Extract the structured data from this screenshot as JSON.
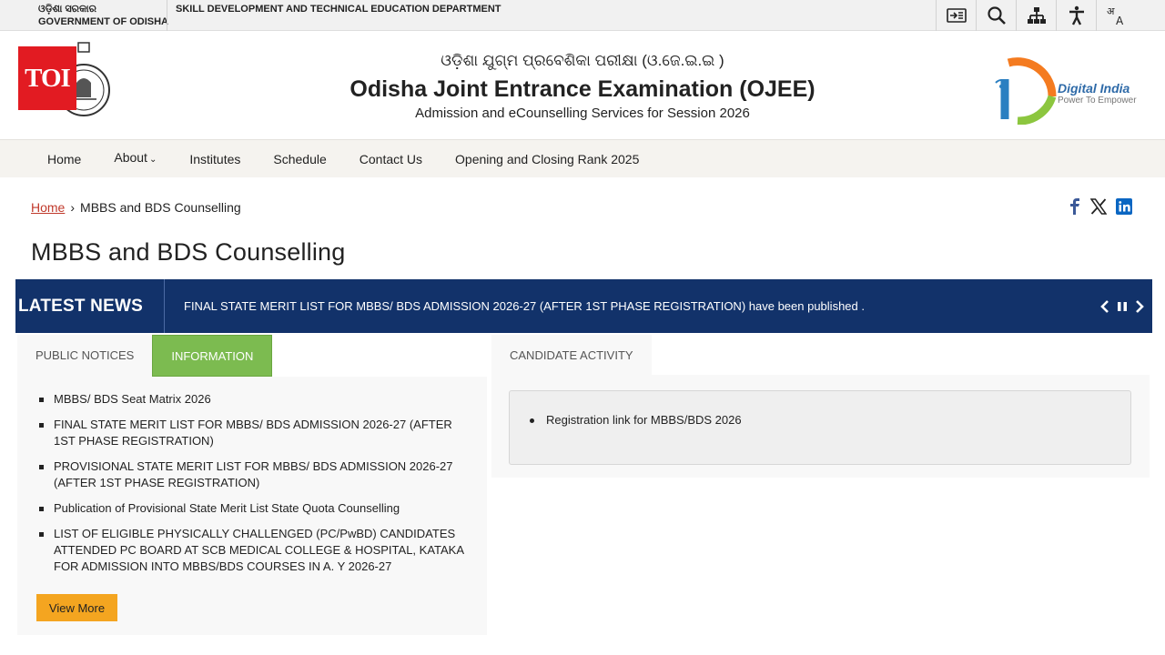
{
  "topbar": {
    "gov_line1": "ଓଡ଼ିଶା ସରକାର",
    "gov_line2": "GOVERNMENT OF ODISHA",
    "department": "SKILL DEVELOPMENT AND TECHNICAL EDUCATION DEPARTMENT",
    "tools": [
      {
        "icon": "skip-to-content-icon"
      },
      {
        "icon": "search-icon"
      },
      {
        "icon": "sitemap-icon"
      },
      {
        "icon": "accessibility-icon"
      },
      {
        "icon": "language-icon"
      }
    ]
  },
  "header": {
    "toi_badge": "TOI",
    "odia_title": "ଓଡ଼ିଶା ଯୁଗ୍ମ ପ୍ରବେଶିକା ପରୀକ୍ଷା (ଓ.ଜେ.ଇ.ଇ )",
    "title": "Odisha Joint Entrance Examination (OJEE)",
    "subtitle": "Admission and eCounselling Services for Session 2026",
    "digital_india": "Digital India",
    "digital_india_tag": "Power To Empower"
  },
  "nav": {
    "items": [
      "Home",
      "About",
      "Institutes",
      "Schedule",
      "Contact Us",
      "Opening and Closing Rank 2025"
    ]
  },
  "breadcrumb": {
    "home": "Home",
    "separator": "›",
    "current": "MBBS and BDS Counselling"
  },
  "social": [
    "facebook-icon",
    "x-icon",
    "linkedin-icon"
  ],
  "page_title": "MBBS and BDS Counselling",
  "latest_news": {
    "label": "LATEST NEWS",
    "text": "FINAL STATE MERIT LIST FOR MBBS/ BDS ADMISSION 2026-27 (AFTER 1ST PHASE REGISTRATION) have been published ."
  },
  "left_tabs": {
    "tab1": "PUBLIC NOTICES",
    "tab2": "INFORMATION",
    "active": "INFORMATION"
  },
  "information": [
    "MBBS/ BDS Seat Matrix 2026",
    "FINAL STATE MERIT LIST FOR MBBS/ BDS ADMISSION 2026-27 (AFTER 1ST PHASE REGISTRATION)",
    "PROVISIONAL STATE MERIT LIST FOR MBBS/ BDS ADMISSION 2026-27 (AFTER 1ST PHASE REGISTRATION)",
    "Publication of Provisional State Merit List State Quota Counselling",
    "LIST OF ELIGIBLE PHYSICALLY CHALLENGED (PC/PwBD) CANDIDATES ATTENDED PC BOARD AT SCB MEDICAL COLLEGE & HOSPITAL, KATAKA FOR ADMISSION INTO MBBS/BDS COURSES IN A. Y 2026-27"
  ],
  "view_more": "View More",
  "candidate_activity": {
    "tab": "CANDIDATE ACTIVITY",
    "items": [
      "Registration link for MBBS/BDS 2026"
    ]
  },
  "colors": {
    "news_bg": "#12326a",
    "active_tab": "#7cbb50",
    "view_more_bg": "#f4a520",
    "breadcrumb_link": "#c0392b"
  }
}
